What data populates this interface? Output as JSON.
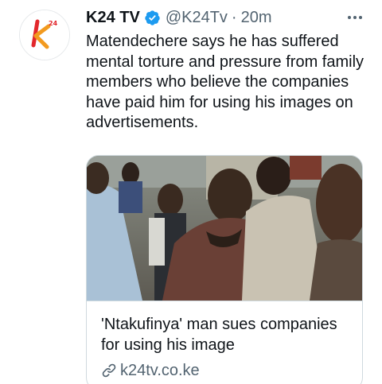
{
  "author": {
    "display_name": "K24 TV",
    "handle": "@K24Tv",
    "separator": "·",
    "time": "20m",
    "avatar_logo_text": "k24"
  },
  "tweet": {
    "text": "Matendechere says he has suffered mental torture and pressure from family members who believe the companies have paid him for using his images on advertisements."
  },
  "card": {
    "title": "'Ntakufinya' man sues companies for using his image",
    "domain": "k24tv.co.ke"
  },
  "icons": {
    "verified": "verified-badge-icon",
    "more": "more-horizontal-icon",
    "link": "link-icon"
  },
  "colors": {
    "text_primary": "#0f1419",
    "text_secondary": "#536471",
    "verified_blue": "#1d9bf0",
    "border": "#cfd9de",
    "logo_orange": "#f29a1f",
    "logo_red": "#e2272c"
  }
}
